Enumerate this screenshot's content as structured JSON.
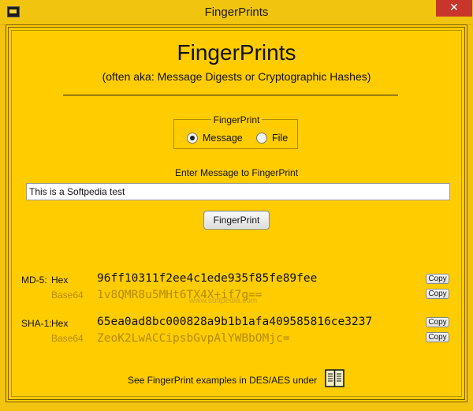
{
  "window": {
    "title": "FingerPrints",
    "close_glyph": "✕"
  },
  "header": {
    "title": "FingerPrints",
    "subtitle": "(often aka: Message Digests or Cryptographic Hashes)"
  },
  "mode_group": {
    "legend": "FingerPrint",
    "options": [
      {
        "label": "Message",
        "selected": true
      },
      {
        "label": "File",
        "selected": false
      }
    ]
  },
  "input": {
    "prompt": "Enter Message to FingerPrint",
    "value": "This is a Softpedia test"
  },
  "action": {
    "label": "FingerPrint"
  },
  "results": {
    "md5": {
      "label": "MD-5:",
      "hex_label": "Hex",
      "base64_label": "Base64",
      "hex": "96ff10311f2ee4c1ede935f85fe89fee",
      "base64": "1v8QMR8u5MHt6TX4X+if7g=="
    },
    "sha1": {
      "label": "SHA-1:",
      "hex_label": "Hex",
      "base64_label": "Base64",
      "hex": "65ea0ad8bc000828a9b1b1afa409585816ce3237",
      "base64": "ZeoK2LwACCipsbGvpAlYWBbOMjc="
    },
    "copy_label": "Copy"
  },
  "watermark": "www.softpedia.com",
  "footer": {
    "text": "See FingerPrint examples in DES/AES under",
    "icon": "book-icon"
  },
  "colors": {
    "background": "#ffcc00",
    "base64_text": "#b58b00",
    "close_button": "#c7352b"
  }
}
